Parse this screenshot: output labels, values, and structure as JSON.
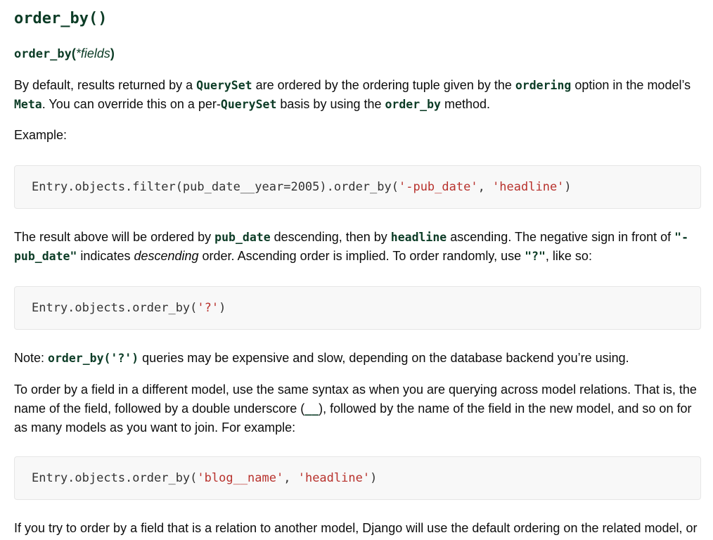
{
  "heading": "order_by()",
  "signature": {
    "name": "order_by",
    "open": "(",
    "args": "*fields",
    "close": ")"
  },
  "p1": {
    "t1": "By default, results returned by a ",
    "c1": "QuerySet",
    "t2": " are ordered by the ordering tuple given by the ",
    "c2": "ordering",
    "t3": " option in the model’s ",
    "c3": "Meta",
    "t4": ". You can override this on a per-",
    "c4": "QuerySet",
    "t5": " basis by using the ",
    "c5": "order_by",
    "t6": " method."
  },
  "p2": "Example:",
  "code1": {
    "pre": "Entry.objects.filter(pub_date__year=2005).order_by(",
    "s1": "'-pub_date'",
    "sep": ", ",
    "s2": "'headline'",
    "post": ")"
  },
  "p3": {
    "t1": "The result above will be ordered by ",
    "c1": "pub_date",
    "t2": " descending, then by ",
    "c2": "headline",
    "t3": " ascending. The negative sign in front of ",
    "c3": "\"-pub_date\"",
    "t4": " indicates ",
    "em": "descending",
    "t5": " order. Ascending order is implied. To order randomly, use ",
    "c4": "\"?\"",
    "t6": ", like so:"
  },
  "code2": {
    "pre": "Entry.objects.order_by(",
    "s1": "'?'",
    "post": ")"
  },
  "p4": {
    "t1": "Note: ",
    "c1": "order_by('?')",
    "t2": " queries may be expensive and slow, depending on the database backend you’re using."
  },
  "p5": {
    "t1": "To order by a field in a different model, use the same syntax as when you are querying across model relations. That is, the name of the field, followed by a double underscore (",
    "c1": "__",
    "t2": "), followed by the name of the field in the new model, and so on for as many models as you want to join. For example:"
  },
  "code3": {
    "pre": "Entry.objects.order_by(",
    "s1": "'blog__name'",
    "sep": ", ",
    "s2": "'headline'",
    "post": ")"
  },
  "p6": "If you try to order by a field that is a relation to another model, Django will use the default ordering on the related model, or"
}
